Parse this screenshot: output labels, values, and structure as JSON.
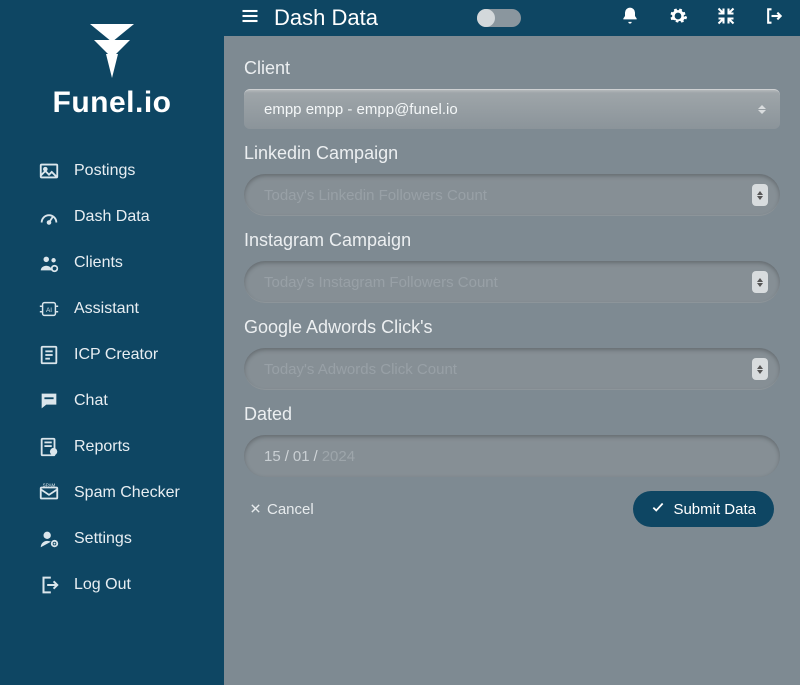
{
  "brand": {
    "name": "Funel.io"
  },
  "topbar": {
    "title": "Dash Data"
  },
  "sidebar": {
    "items": [
      {
        "label": "Postings"
      },
      {
        "label": "Dash Data"
      },
      {
        "label": "Clients"
      },
      {
        "label": "Assistant"
      },
      {
        "label": "ICP Creator"
      },
      {
        "label": "Chat"
      },
      {
        "label": "Reports"
      },
      {
        "label": "Spam Checker"
      },
      {
        "label": "Settings"
      },
      {
        "label": "Log Out"
      }
    ]
  },
  "form": {
    "client": {
      "label": "Client",
      "value": "empp empp - empp@funel.io"
    },
    "linkedin": {
      "label": "Linkedin Campaign",
      "placeholder": "Today's Linkedin Followers Count"
    },
    "instagram": {
      "label": "Instagram Campaign",
      "placeholder": "Today's Instagram Followers Count"
    },
    "adwords": {
      "label": "Google Adwords Click's",
      "placeholder": "Today's Adwords Click Count"
    },
    "dated": {
      "label": "Dated",
      "day": "15",
      "month": "01",
      "year": "2024"
    },
    "cancel_label": "Cancel",
    "submit_label": "Submit Data"
  }
}
